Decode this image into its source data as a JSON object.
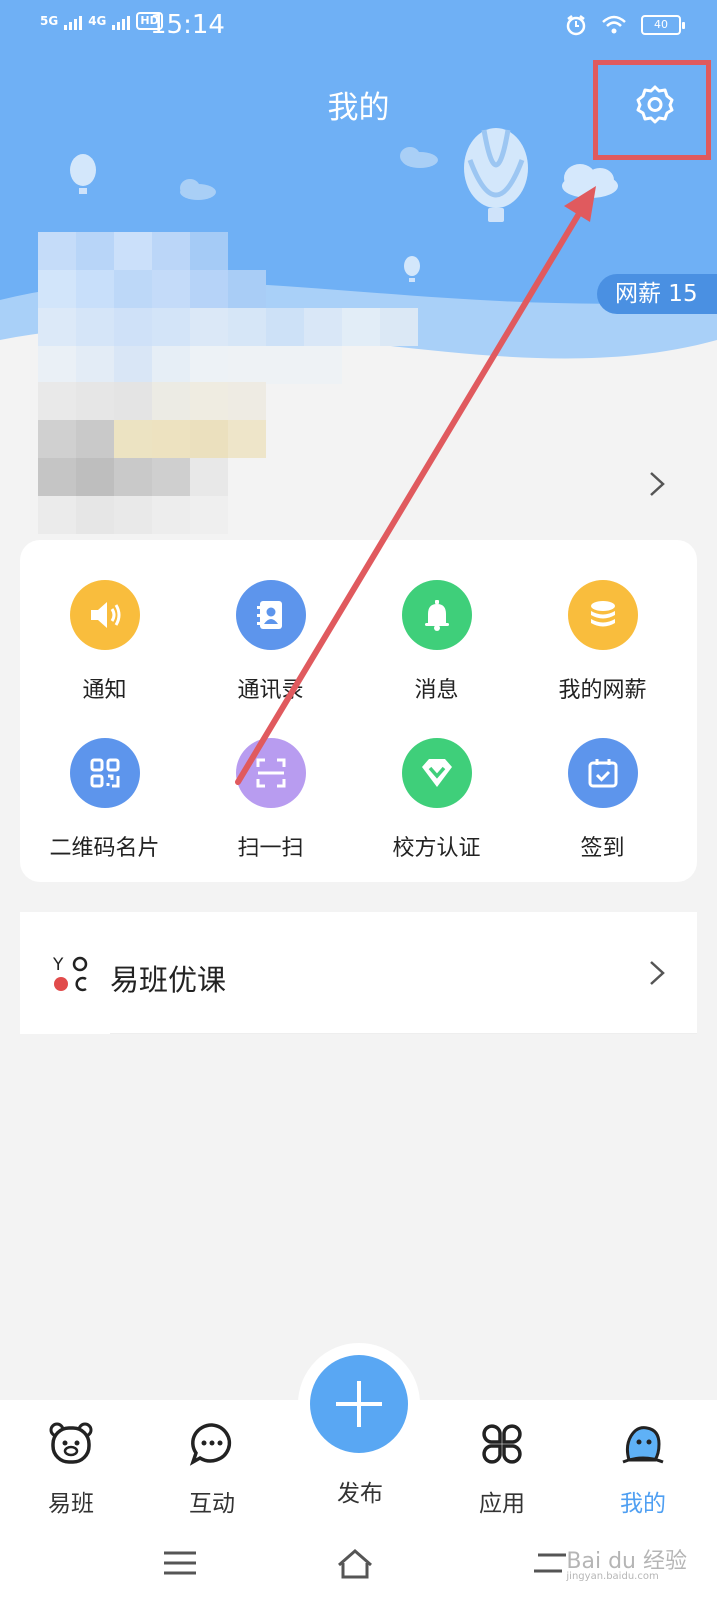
{
  "status_bar": {
    "net1": "5G",
    "net2": "4G",
    "hd": "HD",
    "time": "15:14",
    "battery": "40"
  },
  "header": {
    "title": "我的",
    "salary_chip": "网薪 15",
    "background_color": "#6fb0f5"
  },
  "grid": {
    "items": [
      {
        "label": "通知",
        "icon": "speaker-icon",
        "color": "#f9bd3d"
      },
      {
        "label": "通讯录",
        "icon": "contacts-icon",
        "color": "#5d95ec"
      },
      {
        "label": "消息",
        "icon": "bell-icon",
        "color": "#3fcf7a"
      },
      {
        "label": "我的网薪",
        "icon": "coins-icon",
        "color": "#f9bd3d"
      },
      {
        "label": "二维码名片",
        "icon": "qrcode-icon",
        "color": "#5d95ec"
      },
      {
        "label": "扫一扫",
        "icon": "scan-icon",
        "color": "#b89cf0"
      },
      {
        "label": "校方认证",
        "icon": "badge-icon",
        "color": "#3fcf7a"
      },
      {
        "label": "签到",
        "icon": "calendar-check-icon",
        "color": "#5d95ec"
      }
    ]
  },
  "course": {
    "label": "易班优课",
    "logo_text": "YO OC"
  },
  "bottom_nav": {
    "items": [
      {
        "label": "易班",
        "icon": "bear-icon"
      },
      {
        "label": "互动",
        "icon": "chat-icon"
      },
      {
        "label": "发布",
        "icon": "plus-icon"
      },
      {
        "label": "应用",
        "icon": "apps-icon"
      },
      {
        "label": "我的",
        "icon": "profile-icon"
      }
    ],
    "active_index": 4,
    "active_color": "#4f9ff2"
  },
  "watermark": {
    "text": "Bai du 经验",
    "sub": "jingyan.baidu.com"
  }
}
